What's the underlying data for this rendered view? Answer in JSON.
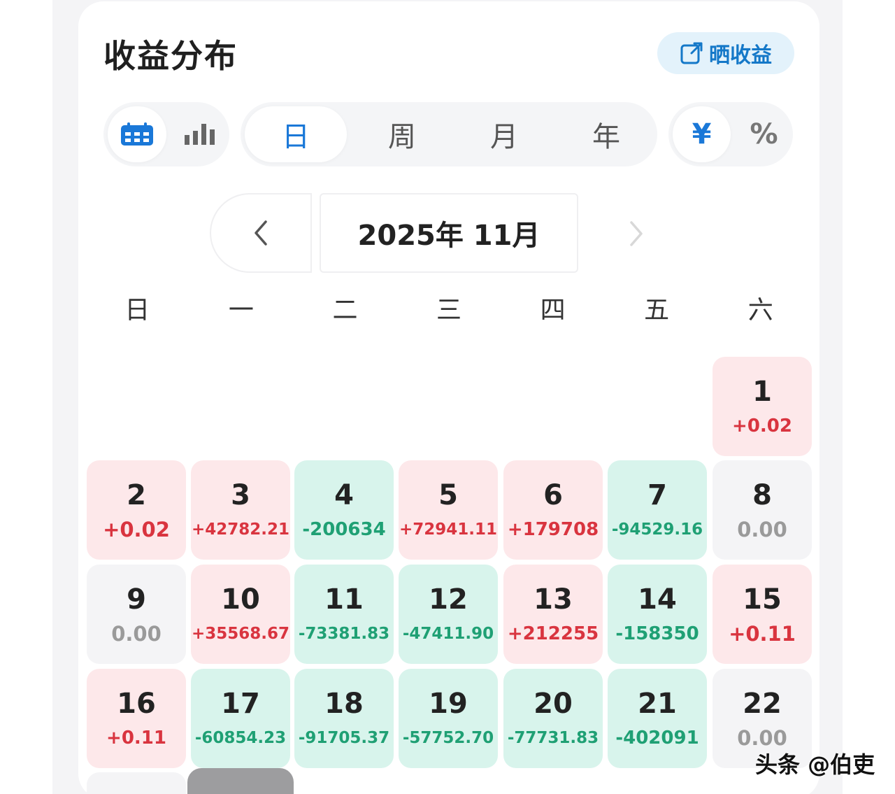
{
  "header": {
    "title": "收益分布",
    "share_label": "晒收益"
  },
  "view_toggle": {
    "items": [
      {
        "icon": "calendar-icon",
        "active": true
      },
      {
        "icon": "bar-chart-icon",
        "active": false
      }
    ]
  },
  "period_tabs": {
    "items": [
      "日",
      "周",
      "月",
      "年"
    ],
    "active_index": 0
  },
  "unit_toggle": {
    "items": [
      "¥",
      "%"
    ],
    "active_index": 0
  },
  "month_nav": {
    "label": "2025年 11月"
  },
  "weekdays": [
    "日",
    "一",
    "二",
    "三",
    "四",
    "五",
    "六"
  ],
  "colors": {
    "accent": "#1a78d8",
    "gain_bg": "#fde8ea",
    "gain_text": "#d9343f",
    "loss_bg": "#d8f4ec",
    "loss_text": "#1fa074",
    "flat_bg": "#f4f4f6"
  },
  "calendar": {
    "days": [
      {
        "day": "1",
        "value": "+0.02",
        "trend": "up"
      },
      {
        "day": "2",
        "value": "+0.02",
        "trend": "up"
      },
      {
        "day": "3",
        "value": "+42782.21",
        "trend": "up"
      },
      {
        "day": "4",
        "value": "-200634",
        "trend": "down"
      },
      {
        "day": "5",
        "value": "+72941.11",
        "trend": "up"
      },
      {
        "day": "6",
        "value": "+179708",
        "trend": "up"
      },
      {
        "day": "7",
        "value": "-94529.16",
        "trend": "down"
      },
      {
        "day": "8",
        "value": "0.00",
        "trend": "flat"
      },
      {
        "day": "9",
        "value": "0.00",
        "trend": "flat"
      },
      {
        "day": "10",
        "value": "+35568.67",
        "trend": "up"
      },
      {
        "day": "11",
        "value": "-73381.83",
        "trend": "down"
      },
      {
        "day": "12",
        "value": "-47411.90",
        "trend": "down"
      },
      {
        "day": "13",
        "value": "+212255",
        "trend": "up"
      },
      {
        "day": "14",
        "value": "-158350",
        "trend": "down"
      },
      {
        "day": "15",
        "value": "+0.11",
        "trend": "up"
      },
      {
        "day": "16",
        "value": "+0.11",
        "trend": "up"
      },
      {
        "day": "17",
        "value": "-60854.23",
        "trend": "down"
      },
      {
        "day": "18",
        "value": "-91705.37",
        "trend": "down"
      },
      {
        "day": "19",
        "value": "-57752.70",
        "trend": "down"
      },
      {
        "day": "20",
        "value": "-77731.83",
        "trend": "down"
      },
      {
        "day": "21",
        "value": "-402091",
        "trend": "down"
      },
      {
        "day": "22",
        "value": "0.00",
        "trend": "flat"
      }
    ]
  },
  "watermark": "头条 @伯吏"
}
